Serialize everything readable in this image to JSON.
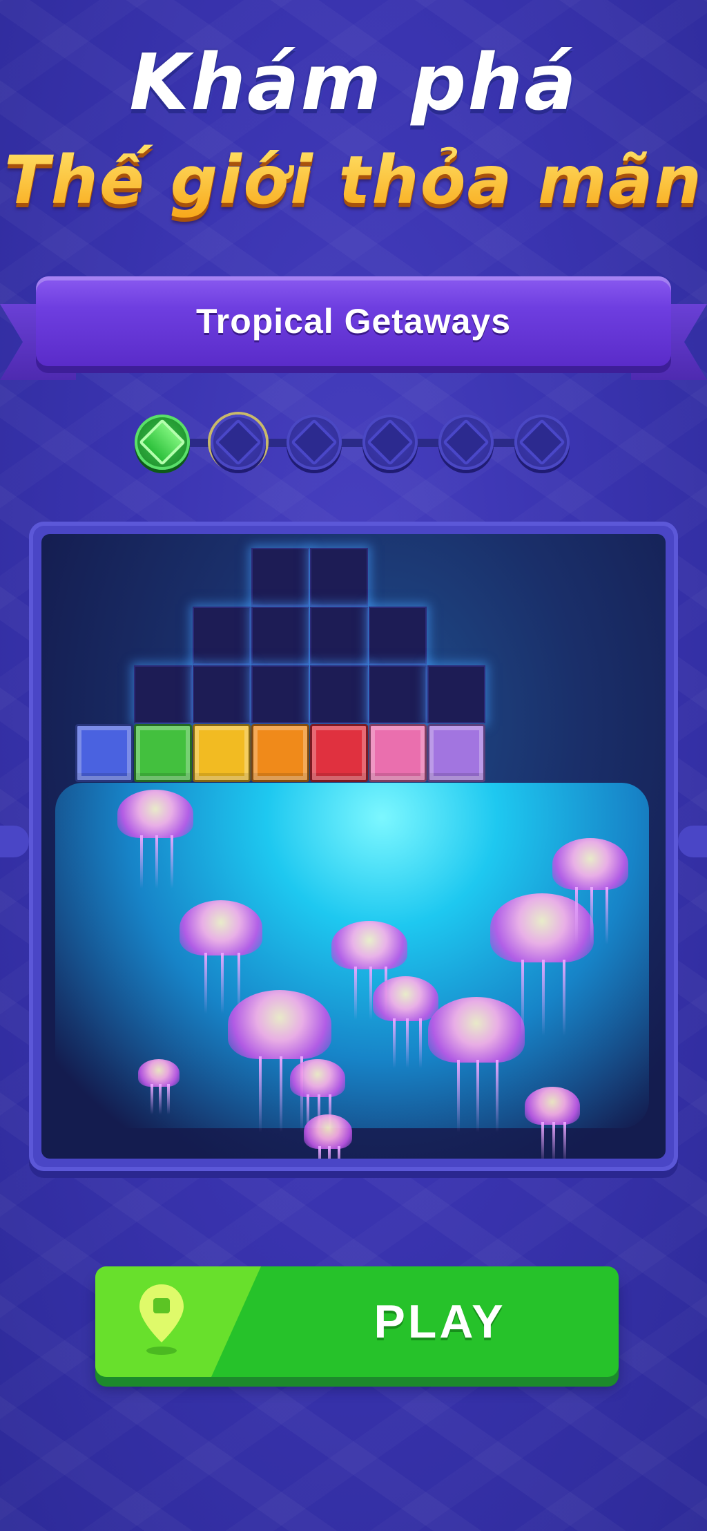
{
  "headline": {
    "line1": "Khám phá",
    "line2": "Thế giới thỏa mãn"
  },
  "level": {
    "title": "Tropical Getaways",
    "progress": {
      "completed": 1,
      "current": 2,
      "total": 6
    }
  },
  "board": {
    "block_colors": [
      "#4a62e0",
      "#43c03e",
      "#f2bb22",
      "#f08a1a",
      "#e0313f",
      "#ea6fae",
      "#a275e0"
    ],
    "glow_color": "#29d4ff"
  },
  "play_button": {
    "label": "PLAY",
    "icon": "map-pin-icon"
  },
  "colors": {
    "background": "#3a34b0",
    "ribbon": "#6e3ee0",
    "play": "#26c22a",
    "headline_yellow": "#ffc72c"
  }
}
